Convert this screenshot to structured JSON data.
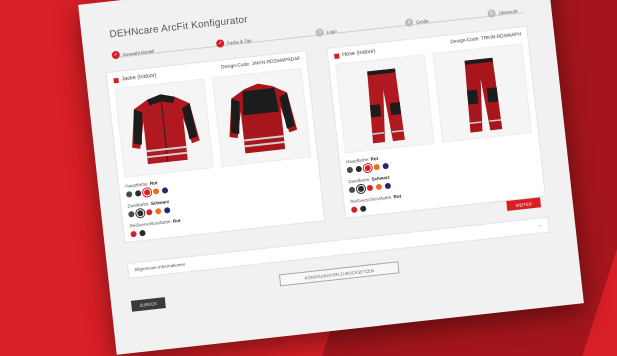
{
  "app": {
    "title": "DEHNcare ArcFit Konfigurator"
  },
  "steps": [
    {
      "label": "Auswahl Modell",
      "num": "✓",
      "done": true
    },
    {
      "label": "Farbe & Typ",
      "num": "✓",
      "done": true
    },
    {
      "label": "Logo",
      "num": "3",
      "done": false
    },
    {
      "label": "Größe",
      "num": "4",
      "done": false
    },
    {
      "label": "Übersicht",
      "num": "5",
      "done": false
    }
  ],
  "jacket": {
    "name": "Jacke (Indoor)",
    "design_code": "Design-Code: JAKIN-RDSWAPRDAF",
    "main_color_label": "Hauptfarbe:",
    "main_color_value": "Rot",
    "second_color_label": "Zweitfarbe:",
    "second_color_value": "Schwarz",
    "piping_label": "Reißverschlussfarbe:",
    "piping_value": "Rot"
  },
  "trousers": {
    "name": "Hose (Indoor)",
    "design_code": "Design-Code: TRKIN-RDSWAPH",
    "main_color_label": "Hauptfarbe:",
    "main_color_value": "Rot",
    "second_color_label": "Zweitfarbe:",
    "second_color_value": "Schwarz",
    "piping_label": "Reißverschlussfarbe:",
    "piping_value": "Rot"
  },
  "colors": {
    "accent": "#d81f26",
    "swatches": [
      "#4a4a4a",
      "#2a2a2a",
      "#d81f26",
      "#e8711e",
      "#1f2c6e"
    ]
  },
  "general_info": "Allgemeine Informationen",
  "buttons": {
    "next": "WEITER",
    "reset": "KONFIGURATION ZURÜCKSETZEN",
    "back": "ZURÜCK"
  }
}
